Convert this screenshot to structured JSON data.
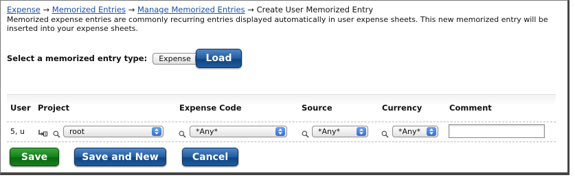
{
  "breadcrumb": {
    "items": [
      "Expense",
      "Memorized Entries",
      "Manage Memorized Entries"
    ],
    "current": "Create User Memorized Entry",
    "separator": "→"
  },
  "description": "Memorized expense entries are commonly recurring entries displayed automatically in user expense sheets. This new memorized entry will be inserted into your expense sheets.",
  "type_selector": {
    "label": "Select a memorized entry type:",
    "value": "Expense",
    "load_label": "Load"
  },
  "table": {
    "headers": [
      "User",
      "Project",
      "Expense Code",
      "Source",
      "Currency",
      "Comment"
    ],
    "row": {
      "user": "5, u",
      "project": "root",
      "expense_code": "*Any*",
      "source": "*Any*",
      "currency": "*Any*",
      "comment": ""
    }
  },
  "actions": {
    "save": "Save",
    "save_and_new": "Save and New",
    "cancel": "Cancel"
  },
  "colors": {
    "link": "#1a4fa8",
    "primary_button": "#245d9f",
    "save_button": "#17801b"
  },
  "icons": [
    "search-icon",
    "hierarchy-icon",
    "dropdown-arrows-icon"
  ]
}
